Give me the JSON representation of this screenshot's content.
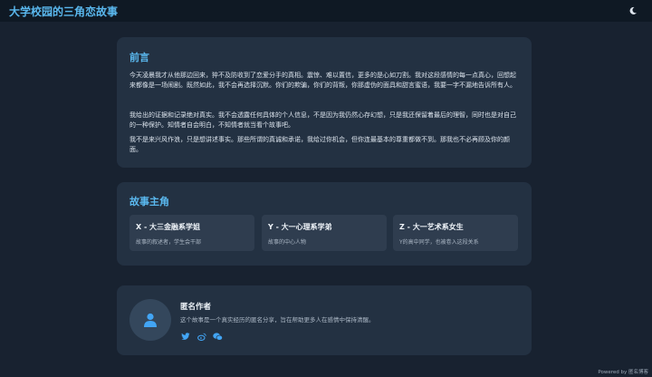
{
  "header": {
    "title": "大学校园的三角恋故事"
  },
  "preface": {
    "heading": "前言",
    "paragraphs": [
      "今天凌晨我才从他那边回来，猝不及防收到了恋爱分手的真相。震惊、难以置信，更多的是心如刀割。我对这段感情的每一点真心，回想起来都像是一场闹剧。既然如此，我不会再选择沉默。你们的欺骗，你们的背叛，你那虚伪的面具和甜言蜜语，我要一字不漏地告诉所有人。",
      "我给出的证据和记录绝对真实。我不会透露任何具体的个人信息，不是因为我仍然心存幻想，只是我还保留着最后的理智，同时也是对自己的一种保护。知情者自会明白，不知情者就当看个故事吧。",
      "我不是来兴风作浪，只是想讲述事实。那些所谓的真诚和承诺，我给过你机会，但你连最基本的尊重都做不到。那我也不必再顾及你的颜面。"
    ]
  },
  "characters": {
    "heading": "故事主角",
    "items": [
      {
        "name": "X - 大三金融系学姐",
        "desc": "故事的叙述者，学生会干部"
      },
      {
        "name": "Y - 大一心理系学弟",
        "desc": "故事的中心人物"
      },
      {
        "name": "Z - 大一艺术系女生",
        "desc": "Y的高中同学，也被卷入这段关系"
      }
    ]
  },
  "author": {
    "name": "匿名作者",
    "bio": "这个故事是一个真实经历的匿名分享，旨在帮助更多人在感情中保持清醒。"
  },
  "footer": {
    "powered": "Powered by 匿名博客"
  },
  "colors": {
    "accent": "#5ab8ee",
    "background": "#182230",
    "card": "#233142"
  },
  "icons": [
    "moon-icon",
    "user-icon",
    "twitter-icon",
    "weibo-icon",
    "wechat-icon"
  ]
}
